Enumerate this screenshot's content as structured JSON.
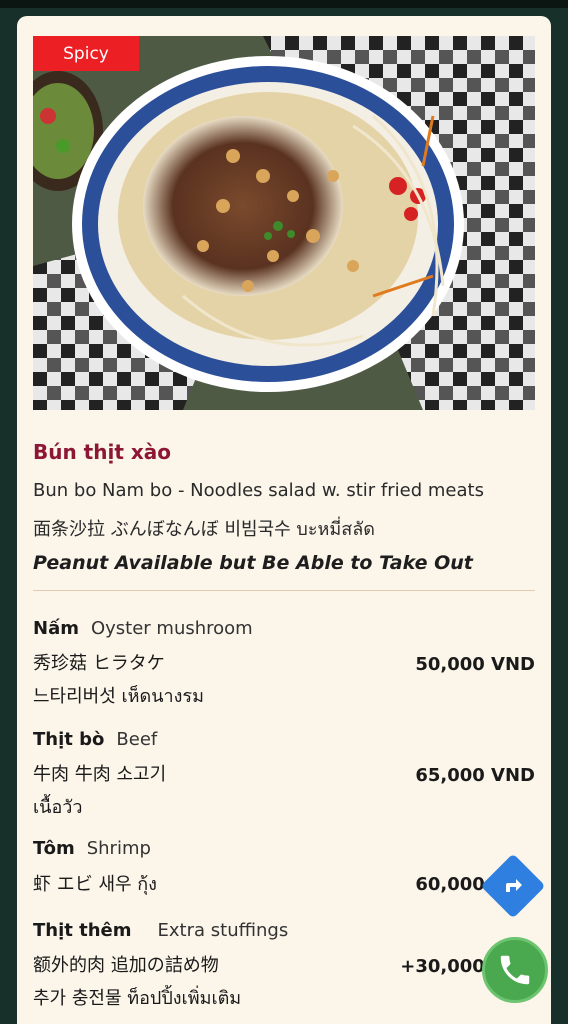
{
  "badge": "Spicy",
  "dish": {
    "title": "Bún thịt xào",
    "description": "Bun bo Nam bo - Noodles salad w. stir fried meats",
    "multilingual": "面条沙拉  ぶんぼなんぼ  비빔국수  บะหมี่สลัด",
    "note": "Peanut Available but Be Able to Take Out"
  },
  "options": [
    {
      "name": "Nấm",
      "english": "Oyster mushroom",
      "line1": "秀珍菇  ヒラタケ",
      "line2": "느타리버섯 เห็ดนางรม",
      "price": "50,000 VND"
    },
    {
      "name": "Thịt bò",
      "english": "Beef",
      "line1": "牛肉  牛肉  소고기",
      "line2": "เนื้อวัว",
      "price": "65,000 VND"
    },
    {
      "name": "Tôm",
      "english": "Shrimp",
      "line1": "虾  エビ  새우  กุ้ง",
      "line2": "",
      "price": "60,000 VND"
    },
    {
      "name": "Thịt thêm",
      "english": "Extra stuffings",
      "line1": "额外的肉  追加の詰め物",
      "line2": "추가 충전물  ท็อปปิ้งเพิ่มเติม",
      "price": "+30,000 VND"
    }
  ],
  "colors": {
    "background": "#17302a",
    "card": "#fbf5ea",
    "title": "#8e1635",
    "badge": "#ec1f24",
    "nav_fab": "#2f7fe0",
    "call_fab": "#4aa84f"
  },
  "icons": {
    "nav": "directions-icon",
    "call": "phone-icon"
  }
}
